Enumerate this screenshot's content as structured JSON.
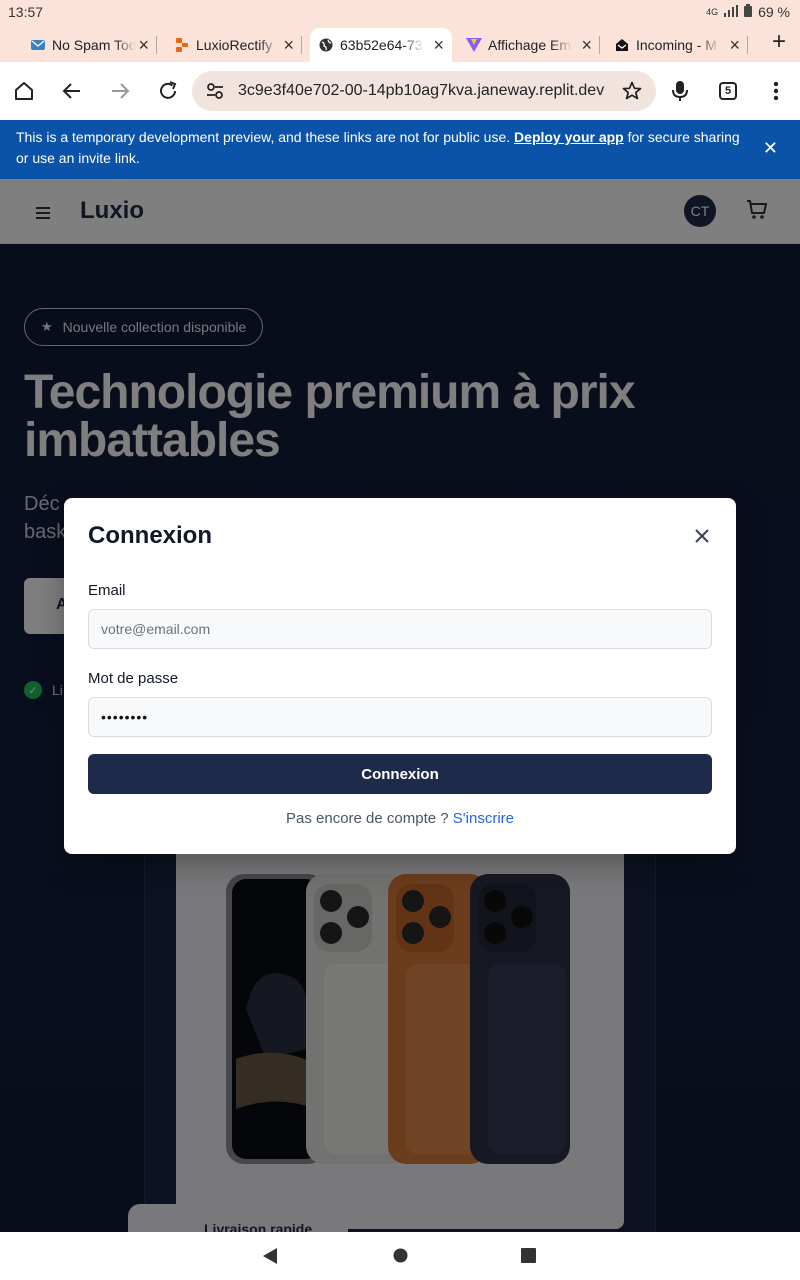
{
  "status_bar": {
    "time": "13:57",
    "network": "4G",
    "battery": "69 %"
  },
  "tabs": [
    {
      "title": "No Spam Tod",
      "favicon": "mail-icon",
      "active": false
    },
    {
      "title": "LuxioRectify",
      "favicon": "replit-icon",
      "active": false
    },
    {
      "title": "63b52e64-73",
      "favicon": "globe-icon",
      "active": true
    },
    {
      "title": "Affichage Em",
      "favicon": "vite-icon",
      "active": false
    },
    {
      "title": "Incoming - M",
      "favicon": "inbox-icon",
      "active": false
    }
  ],
  "toolbar": {
    "url": "3c9e3f40e702-00-14pb10ag7kva.janeway.replit.dev",
    "tab_count": "5"
  },
  "banner": {
    "text_before": "This is a temporary development preview, and these links are not for public use.",
    "link": "Deploy your app",
    "text_after": "for secure sharing or use an invite link."
  },
  "site": {
    "logo": "Luxio",
    "avatar_initials": "CT",
    "hero": {
      "pill": "Nouvelle collection disponible",
      "title": "Technologie premium à prix imbattables",
      "subtitle_visible": "Déc",
      "subtitle_line2": "bask",
      "button": "A",
      "feature": "Li"
    },
    "product_badge": "Livraison rapide"
  },
  "modal": {
    "title": "Connexion",
    "email_label": "Email",
    "email_placeholder": "votre@email.com",
    "password_label": "Mot de passe",
    "password_value": "••••••••",
    "submit_label": "Connexion",
    "signup_text": "Pas encore de compte ?",
    "signup_link": "S'inscrire"
  },
  "colors": {
    "primary": "#1e2a4a",
    "banner": "#0b53a8",
    "link": "#2563eb",
    "hero_bg": "#0f1a35",
    "chrome_tab_bar": "#fbe3d9"
  }
}
